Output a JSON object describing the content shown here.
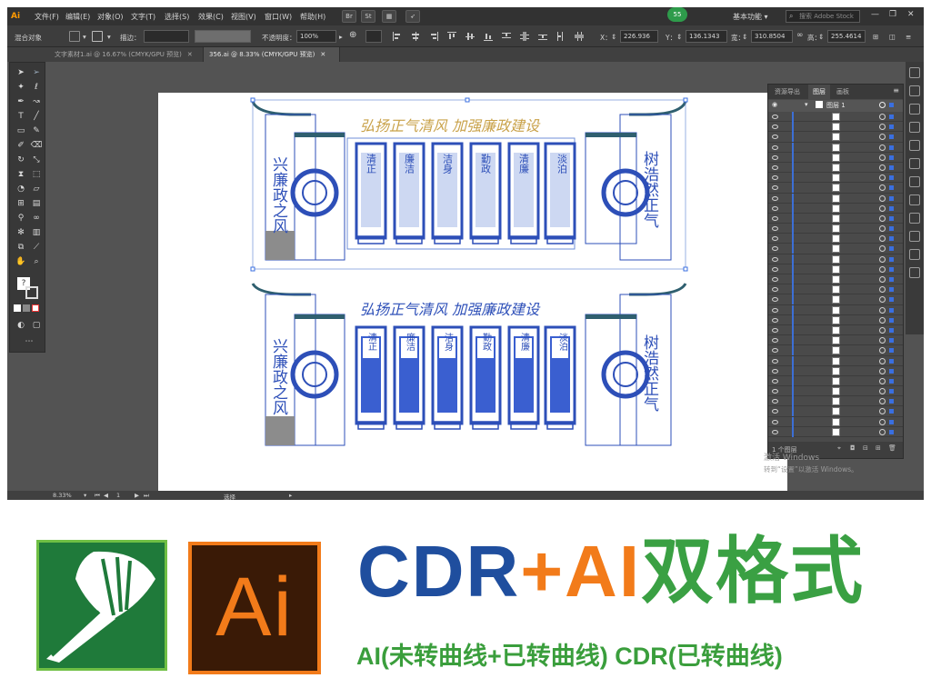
{
  "app": {
    "logo": "Ai",
    "menus": [
      "文件(F)",
      "编辑(E)",
      "对象(O)",
      "文字(T)",
      "选择(S)",
      "效果(C)",
      "视图(V)",
      "窗口(W)",
      "帮助(H)"
    ],
    "buttons": [
      "Br",
      "St"
    ],
    "badge": "55",
    "workspace": "基本功能",
    "stock_search_placeholder": "搜索 Adobe Stock",
    "accent_color": "#ff9a00"
  },
  "control_bar": {
    "selection_label": "混合对象",
    "stroke_label": "描边：",
    "opacity_label": "不透明度：",
    "opacity_value": "100%",
    "x_label": "X：",
    "x_value": "226.936",
    "y_label": "Y：",
    "y_value": "136.1343",
    "w_label": "宽：",
    "w_value": "310.8504",
    "h_label": "高：",
    "h_value": "255.4614"
  },
  "tabs": [
    {
      "label": "文字素材1.ai @ 16.67% (CMYK/GPU 预览)",
      "active": false
    },
    {
      "label": "356.ai @ 8.33% (CMYK/GPU 预览)",
      "active": true
    }
  ],
  "tools": [
    "selection-tool",
    "direct-selection-tool",
    "magic-wand-tool",
    "lasso-tool",
    "pen-tool",
    "curvature-tool",
    "type-tool",
    "line-tool",
    "rectangle-tool",
    "paintbrush-tool",
    "shaper-tool",
    "eraser-tool",
    "rotate-tool",
    "scale-tool",
    "width-tool",
    "free-transform-tool",
    "shape-builder-tool",
    "perspective-tool",
    "mesh-tool",
    "gradient-tool",
    "eyedropper-tool",
    "blend-tool",
    "symbol-sprayer-tool",
    "column-graph-tool",
    "artboard-tool",
    "slice-tool",
    "hand-tool",
    "zoom-tool"
  ],
  "layers_panel": {
    "tabs": [
      "资源导出",
      "图层",
      "画板"
    ],
    "active_tab": "图层",
    "top_layer": "图层 1",
    "footer_label": "1 个图层"
  },
  "status": {
    "zoom": "8.33%",
    "artboard": "1",
    "tool": "选择"
  },
  "watermark": {
    "title": "激活 Windows",
    "subtitle": "转到“设置”以激活 Windows。"
  },
  "artwork": {
    "slogan": "弘扬正气清风  加强廉政建设",
    "left_panel_text": "兴廉政之风",
    "right_panel_text": "树浩然正气",
    "panels": [
      "清正",
      "廉洁",
      "洁身",
      "勤政",
      "清廉",
      "淡泊"
    ],
    "brand_color": "#2d4fb8",
    "roof_color": "#2f5f6f"
  },
  "banner": {
    "cdr_text": "CDR",
    "plus_text": "+",
    "ai_text": "AI",
    "format_text": "双格式",
    "ai_logo_text": "Ai",
    "subline": "AI(未转曲线+已转曲线) CDR(已转曲线)",
    "colors": {
      "cdr": "#1f4e9e",
      "ai": "#f27b1a",
      "format": "#3aa043"
    }
  }
}
